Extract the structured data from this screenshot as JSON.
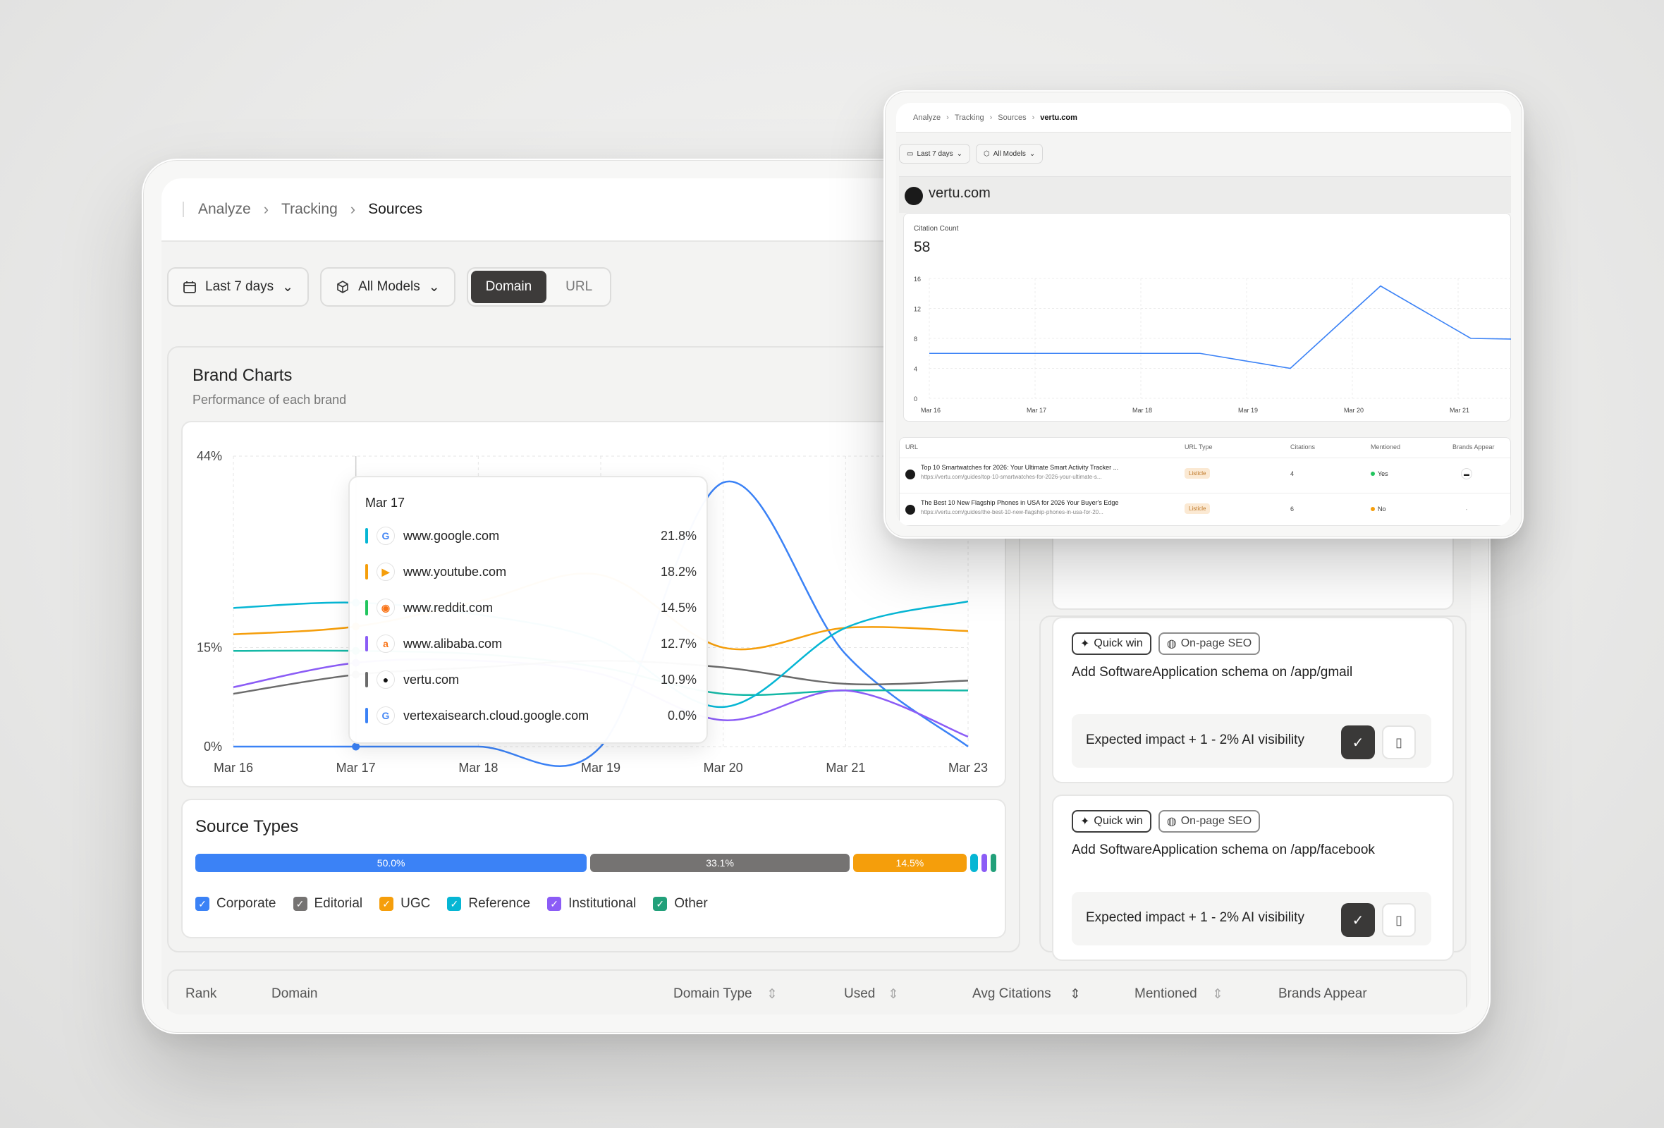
{
  "breadcrumb": [
    "Analyze",
    "Tracking",
    "Sources"
  ],
  "filters": {
    "date": "Last 7 days",
    "models": "All Models",
    "view_options": [
      "Domain",
      "URL"
    ],
    "active_view": "Domain"
  },
  "brand_charts": {
    "title": "Brand Charts",
    "subtitle": "Performance of each brand",
    "chart_data": {
      "type": "line",
      "x": [
        "Mar 16",
        "Mar 17",
        "Mar 18",
        "Mar 19",
        "Mar 20",
        "Mar 21",
        "Mar 23"
      ],
      "y_ticks": [
        "44%",
        "15%",
        "0%"
      ],
      "ylim": [
        0,
        44
      ],
      "series": [
        {
          "name": "www.google.com",
          "color": "#3b82f6",
          "values": [
            0,
            0,
            0,
            0,
            40,
            14,
            0
          ]
        },
        {
          "name": "www.youtube.com",
          "color": "#f59e0b",
          "values": [
            17,
            18.2,
            22,
            26,
            15,
            18,
            17.5
          ]
        },
        {
          "name": "www.reddit.com",
          "color": "#14b8a6",
          "values": [
            14.5,
            14.5,
            14,
            12,
            8,
            8.5,
            8.5
          ]
        },
        {
          "name": "www.alibaba.com",
          "color": "#8b5cf6",
          "values": [
            9,
            12.7,
            13,
            11,
            4,
            8.5,
            1.5
          ]
        },
        {
          "name": "vertu.com",
          "color": "#6b6b6b",
          "values": [
            8,
            10.9,
            12,
            13,
            12,
            9.5,
            10
          ]
        },
        {
          "name": "vertexaisearch.cloud.google.com",
          "color": "#06b6d4",
          "values": [
            21,
            21.8,
            20,
            16,
            6,
            18,
            22
          ]
        }
      ]
    },
    "tooltip": {
      "date": "Mar 17",
      "rows": [
        {
          "domain": "www.google.com",
          "value": "21.8%",
          "color": "#06b6d4",
          "icon": "G",
          "icon_color": "#4285f4"
        },
        {
          "domain": "www.youtube.com",
          "value": "18.2%",
          "color": "#f59e0b",
          "icon": "▶",
          "icon_color": "#f59e0b"
        },
        {
          "domain": "www.reddit.com",
          "value": "14.5%",
          "color": "#22c55e",
          "icon": "◉",
          "icon_color": "#f97316"
        },
        {
          "domain": "www.alibaba.com",
          "value": "12.7%",
          "color": "#8b5cf6",
          "icon": "a",
          "icon_color": "#f97316"
        },
        {
          "domain": "vertu.com",
          "value": "10.9%",
          "color": "#6b6b6b",
          "icon": "●",
          "icon_color": "#111111"
        },
        {
          "domain": "vertexaisearch.cloud.google.com",
          "value": "0.0%",
          "color": "#3b82f6",
          "icon": "G",
          "icon_color": "#4285f4"
        }
      ]
    }
  },
  "source_types": {
    "title": "Source Types",
    "segments": [
      {
        "label": "50.0%",
        "value": 50.0,
        "color": "#3b82f6"
      },
      {
        "label": "33.1%",
        "value": 33.1,
        "color": "#757372"
      },
      {
        "label": "14.5%",
        "value": 14.5,
        "color": "#f59e0b"
      },
      {
        "label": "",
        "value": 1.0,
        "color": "#06b6d4"
      },
      {
        "label": "",
        "value": 0.7,
        "color": "#8b5cf6"
      },
      {
        "label": "",
        "value": 0.7,
        "color": "#22a07a"
      }
    ],
    "legend": [
      {
        "label": "Corporate",
        "color": "#3b82f6"
      },
      {
        "label": "Editorial",
        "color": "#757372"
      },
      {
        "label": "UGC",
        "color": "#f59e0b"
      },
      {
        "label": "Reference",
        "color": "#06b6d4"
      },
      {
        "label": "Institutional",
        "color": "#8b5cf6"
      },
      {
        "label": "Other",
        "color": "#22a07a"
      }
    ]
  },
  "recommendations": [
    {
      "tags": [
        "Quick win",
        "On-page SEO"
      ],
      "title": "Add SoftwareApplication schema on /app/gmail",
      "impact": "Expected impact + 1 - 2% AI visibility"
    },
    {
      "tags": [
        "Quick win",
        "On-page SEO"
      ],
      "title": "Add SoftwareApplication schema on /app/facebook",
      "impact": "Expected impact + 1 - 2% AI visibility"
    }
  ],
  "table": {
    "headers": [
      "Rank",
      "Domain",
      "Domain Type",
      "Used",
      "Avg Citations",
      "Mentioned",
      "Brands Appear"
    ]
  },
  "detail": {
    "breadcrumb": [
      "Analyze",
      "Tracking",
      "Sources",
      "vertu.com"
    ],
    "filters": {
      "date": "Last 7 days",
      "models": "All Models"
    },
    "domain": "vertu.com",
    "citation_label": "Citation Count",
    "citation_value": "58",
    "chart_data": {
      "type": "line",
      "x": [
        "Mar 16",
        "Mar 17",
        "Mar 18",
        "Mar 19",
        "Mar 20",
        "Mar 21"
      ],
      "y_ticks": [
        "16",
        "12",
        "8",
        "4",
        "0"
      ],
      "ylim": [
        0,
        16
      ],
      "series": [
        {
          "color": "#3b82f6",
          "values": [
            6,
            6,
            6,
            6,
            4,
            15,
            8,
            7.8
          ]
        }
      ]
    },
    "table_headers": [
      "URL",
      "URL Type",
      "Citations",
      "Mentioned",
      "Brands Appear"
    ],
    "rows": [
      {
        "title": "Top 10 Smartwatches for 2026: Your Ultimate Smart Activity Tracker ...",
        "url": "https://vertu.com/guides/top-10-smartwatches-for-2026-your-ultimate-s...",
        "type": "Listicle",
        "citations": "4",
        "mentioned": "Yes",
        "mentioned_color": "#22c55e"
      },
      {
        "title": "The Best 10 New Flagship Phones in USA for 2026 Your Buyer's Edge",
        "url": "https://vertu.com/guides/the-best-10-new-flagship-phones-in-usa-for-20...",
        "type": "Listicle",
        "citations": "6",
        "mentioned": "No",
        "mentioned_color": "#f59e0b"
      }
    ]
  }
}
